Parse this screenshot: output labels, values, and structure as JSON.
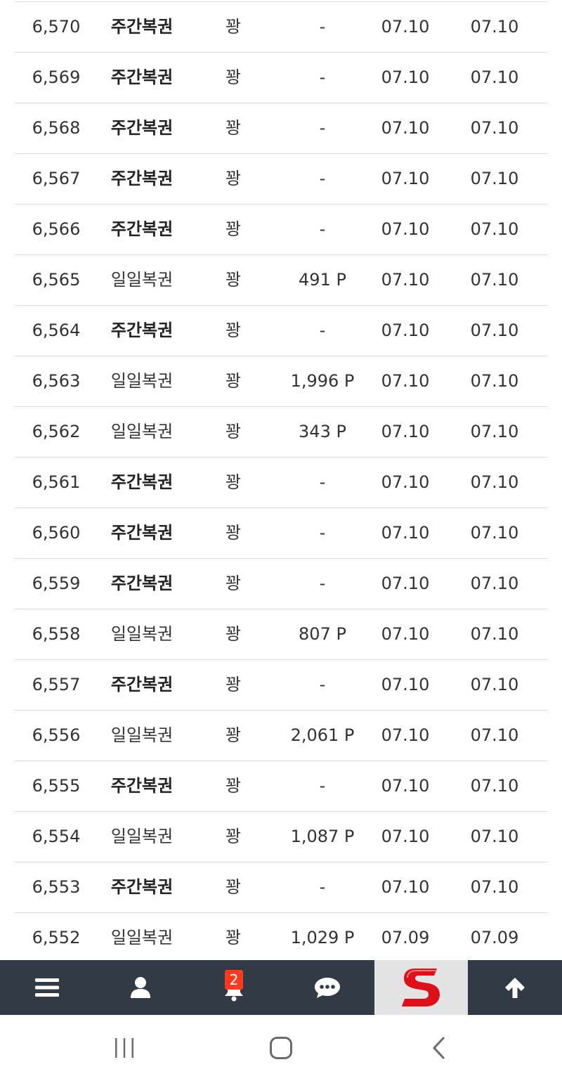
{
  "rows": [
    {
      "no": "6,570",
      "type": "주간복권",
      "bold": true,
      "result": "꽝",
      "points": "-",
      "date1": "07.10",
      "date2": "07.10"
    },
    {
      "no": "6,569",
      "type": "주간복권",
      "bold": true,
      "result": "꽝",
      "points": "-",
      "date1": "07.10",
      "date2": "07.10"
    },
    {
      "no": "6,568",
      "type": "주간복권",
      "bold": true,
      "result": "꽝",
      "points": "-",
      "date1": "07.10",
      "date2": "07.10"
    },
    {
      "no": "6,567",
      "type": "주간복권",
      "bold": true,
      "result": "꽝",
      "points": "-",
      "date1": "07.10",
      "date2": "07.10"
    },
    {
      "no": "6,566",
      "type": "주간복권",
      "bold": true,
      "result": "꽝",
      "points": "-",
      "date1": "07.10",
      "date2": "07.10"
    },
    {
      "no": "6,565",
      "type": "일일복권",
      "bold": false,
      "result": "꽝",
      "points": "491 P",
      "date1": "07.10",
      "date2": "07.10"
    },
    {
      "no": "6,564",
      "type": "주간복권",
      "bold": true,
      "result": "꽝",
      "points": "-",
      "date1": "07.10",
      "date2": "07.10"
    },
    {
      "no": "6,563",
      "type": "일일복권",
      "bold": false,
      "result": "꽝",
      "points": "1,996 P",
      "date1": "07.10",
      "date2": "07.10"
    },
    {
      "no": "6,562",
      "type": "일일복권",
      "bold": false,
      "result": "꽝",
      "points": "343 P",
      "date1": "07.10",
      "date2": "07.10"
    },
    {
      "no": "6,561",
      "type": "주간복권",
      "bold": true,
      "result": "꽝",
      "points": "-",
      "date1": "07.10",
      "date2": "07.10"
    },
    {
      "no": "6,560",
      "type": "주간복권",
      "bold": true,
      "result": "꽝",
      "points": "-",
      "date1": "07.10",
      "date2": "07.10"
    },
    {
      "no": "6,559",
      "type": "주간복권",
      "bold": true,
      "result": "꽝",
      "points": "-",
      "date1": "07.10",
      "date2": "07.10"
    },
    {
      "no": "6,558",
      "type": "일일복권",
      "bold": false,
      "result": "꽝",
      "points": "807 P",
      "date1": "07.10",
      "date2": "07.10"
    },
    {
      "no": "6,557",
      "type": "주간복권",
      "bold": true,
      "result": "꽝",
      "points": "-",
      "date1": "07.10",
      "date2": "07.10"
    },
    {
      "no": "6,556",
      "type": "일일복권",
      "bold": false,
      "result": "꽝",
      "points": "2,061 P",
      "date1": "07.10",
      "date2": "07.10"
    },
    {
      "no": "6,555",
      "type": "주간복권",
      "bold": true,
      "result": "꽝",
      "points": "-",
      "date1": "07.10",
      "date2": "07.10"
    },
    {
      "no": "6,554",
      "type": "일일복권",
      "bold": false,
      "result": "꽝",
      "points": "1,087 P",
      "date1": "07.10",
      "date2": "07.10"
    },
    {
      "no": "6,553",
      "type": "주간복권",
      "bold": true,
      "result": "꽝",
      "points": "-",
      "date1": "07.10",
      "date2": "07.10"
    },
    {
      "no": "6,552",
      "type": "일일복권",
      "bold": false,
      "result": "꽝",
      "points": "1,029 P",
      "date1": "07.09",
      "date2": "07.09"
    }
  ],
  "bottom_nav": {
    "items": [
      {
        "name": "menu",
        "icon": "hamburger-menu-icon"
      },
      {
        "name": "profile",
        "icon": "user-icon"
      },
      {
        "name": "notifications",
        "icon": "bell-icon",
        "badge": "2"
      },
      {
        "name": "chat",
        "icon": "chat-bubble-icon"
      },
      {
        "name": "logo",
        "icon": "red-s-logo"
      },
      {
        "name": "scroll-top",
        "icon": "arrow-up-icon"
      }
    ],
    "background": "#323a45",
    "badge_color": "#ff3b1f",
    "logo_color": "#e0101a"
  },
  "system_nav": {
    "items": [
      {
        "name": "recent-apps",
        "icon": "recent-apps-icon"
      },
      {
        "name": "home",
        "icon": "home-icon"
      },
      {
        "name": "back",
        "icon": "back-icon"
      }
    ]
  }
}
